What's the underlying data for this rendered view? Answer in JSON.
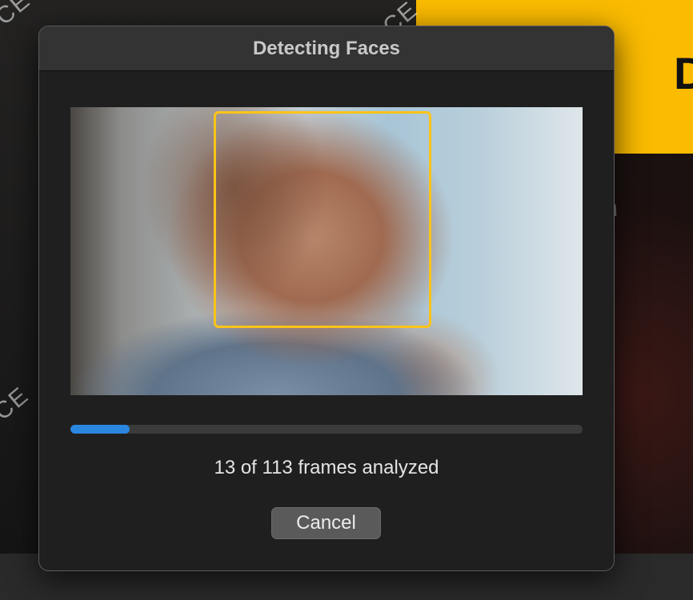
{
  "background": {
    "yellow_panel_text": "D",
    "watermark_glyphs": [
      "CE",
      "CE",
      "CE",
      "✓"
    ]
  },
  "dialog": {
    "title": "Detecting Faces",
    "preview": {
      "content": "video frame with detected face",
      "face_box_color": "#fcc418"
    },
    "progress": {
      "current_frame": 13,
      "total_frames": 113,
      "fraction": 0.115,
      "fill_color": "#2b86e0"
    },
    "status_text": "13 of 113 frames analyzed",
    "cancel_label": "Cancel"
  }
}
